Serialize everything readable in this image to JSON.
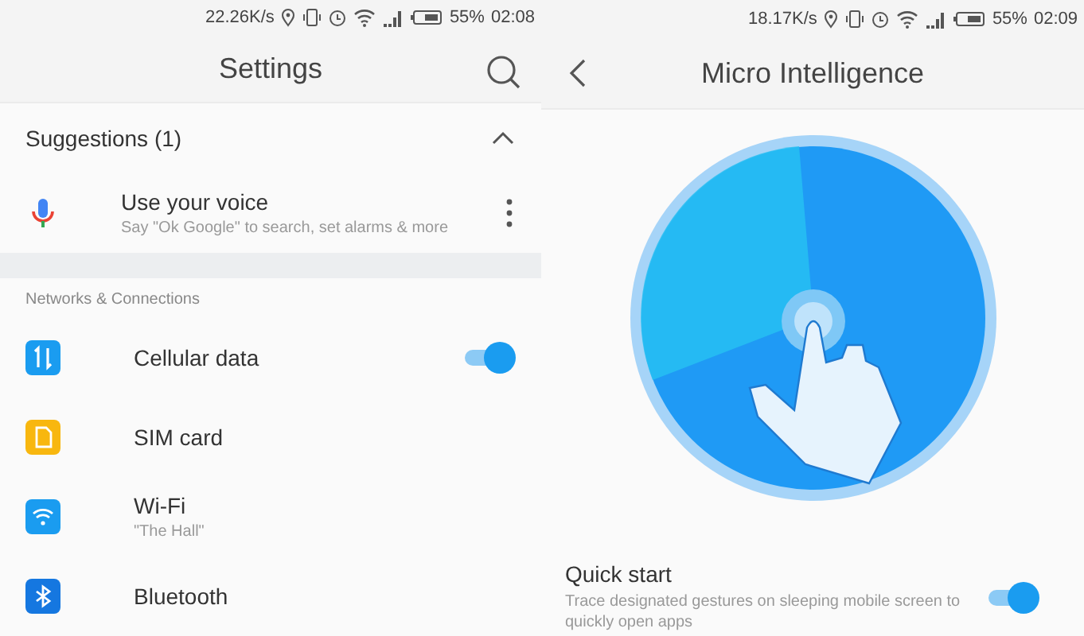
{
  "settings_screen": {
    "status_bar": {
      "speed": "22.26K/s",
      "battery": "55%",
      "time": "02:08"
    },
    "title": "Settings",
    "suggestions": {
      "title": "Suggestions (1)",
      "expanded": true,
      "items": [
        {
          "title": "Use your voice",
          "subtitle": "Say \"Ok Google\" to search, set alarms & more"
        }
      ]
    },
    "section": "Networks & Connections",
    "items": [
      {
        "kind": "toggle",
        "title": "Cellular data",
        "on": true
      },
      {
        "kind": "plain",
        "title": "SIM card"
      },
      {
        "kind": "plain",
        "title": "Wi-Fi",
        "subtitle": "\"The Hall\""
      },
      {
        "kind": "plain",
        "title": "Bluetooth"
      }
    ]
  },
  "micro_intelligence_screen": {
    "status_bar": {
      "speed": "18.17K/s",
      "battery": "55%",
      "time": "02:09"
    },
    "title": "Micro Intelligence",
    "options": [
      {
        "title": "Quick start",
        "subtitle": "Trace designated gestures on sleeping mobile screen to quickly open apps",
        "on": true
      }
    ]
  }
}
